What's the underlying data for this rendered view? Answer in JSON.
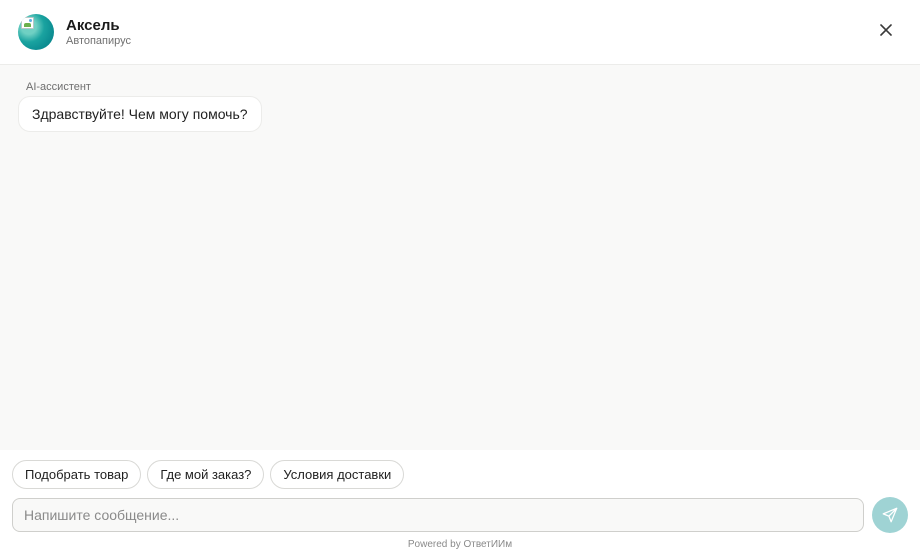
{
  "header": {
    "title": "Аксель",
    "subtitle": "Автопапирус",
    "avatar_icon": "assistant-avatar-icon",
    "close_icon": "close-icon"
  },
  "messages": [
    {
      "sender": "AI-ассистент",
      "text": "Здравствуйте! Чем могу помочь?"
    }
  ],
  "quick_replies": [
    {
      "label": "Подобрать товар"
    },
    {
      "label": "Где мой заказ?"
    },
    {
      "label": "Условия доставки"
    }
  ],
  "composer": {
    "placeholder": "Напишите сообщение...",
    "value": "",
    "send_icon": "send-icon"
  },
  "footer": {
    "powered_by": "Powered by ОтветИИм"
  },
  "colors": {
    "accent": "#9fd3d4",
    "avatar": "#1aa3a0",
    "background": "#f9f9f8"
  }
}
